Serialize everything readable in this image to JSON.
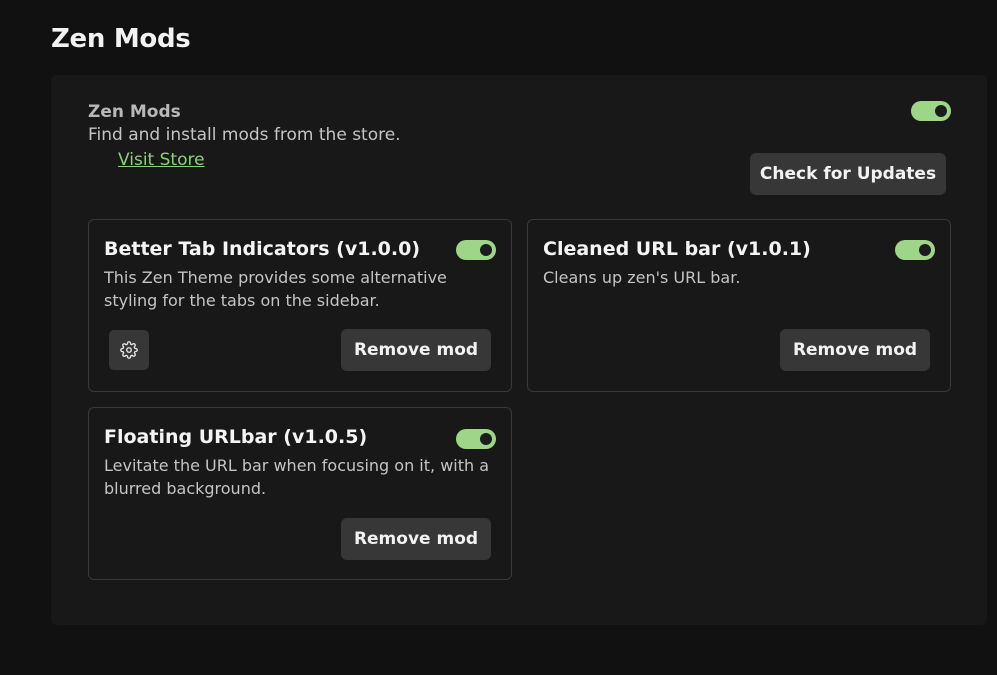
{
  "page": {
    "title": "Zen Mods"
  },
  "header": {
    "title": "Zen Mods",
    "description": "Find and install mods from the store.",
    "visit_store_label": "Visit Store",
    "enabled": true,
    "check_updates_label": "Check for Updates"
  },
  "mods": [
    {
      "name": "Better Tab Indicators (v1.0.0)",
      "description": "This Zen Theme provides some alternative styling for the tabs on the sidebar.",
      "enabled": true,
      "has_settings": true,
      "remove_label": "Remove mod"
    },
    {
      "name": "Cleaned URL bar (v1.0.1)",
      "description": "Cleans up zen's URL bar.",
      "enabled": true,
      "has_settings": false,
      "remove_label": "Remove mod"
    },
    {
      "name": "Floating URLbar (v1.0.5)",
      "description": "Levitate the URL bar when focusing on it, with a blurred background.",
      "enabled": true,
      "has_settings": false,
      "remove_label": "Remove mod"
    }
  ],
  "icons": {
    "settings": "gear-icon"
  },
  "colors": {
    "accent": "#9fd589",
    "link": "#8ccf7e",
    "button_bg": "#373737",
    "panel_bg": "#181818",
    "page_bg": "#111111"
  }
}
